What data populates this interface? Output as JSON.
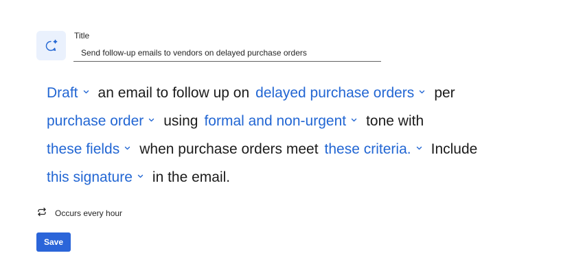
{
  "title_field": {
    "label": "Title",
    "value": "Send follow-up emails to vendors on delayed purchase orders",
    "icon": "sparkle-chat-icon"
  },
  "sentence": {
    "lines": [
      [
        {
          "type": "token",
          "text": "Draft"
        },
        {
          "type": "text",
          "text": "an email to follow up on"
        },
        {
          "type": "token",
          "text": "delayed purchase orders"
        },
        {
          "type": "text",
          "text": "per"
        }
      ],
      [
        {
          "type": "token",
          "text": "purchase order"
        },
        {
          "type": "text",
          "text": "using"
        },
        {
          "type": "token",
          "text": "formal and non-urgent"
        },
        {
          "type": "text",
          "text": "tone with"
        }
      ],
      [
        {
          "type": "token",
          "text": "these fields"
        },
        {
          "type": "text",
          "text": "when purchase orders meet"
        },
        {
          "type": "token",
          "text": "these criteria."
        },
        {
          "type": "text",
          "text": "Include"
        }
      ],
      [
        {
          "type": "token",
          "text": "this signature"
        },
        {
          "type": "text",
          "text": "in the email."
        }
      ]
    ],
    "token_color": "#2266d3",
    "text_color": "#1b1b1b"
  },
  "frequency": {
    "label": "Occurs every hour",
    "icon": "repeat-icon"
  },
  "actions": {
    "save_label": "Save",
    "save_color": "#2b65d9"
  }
}
